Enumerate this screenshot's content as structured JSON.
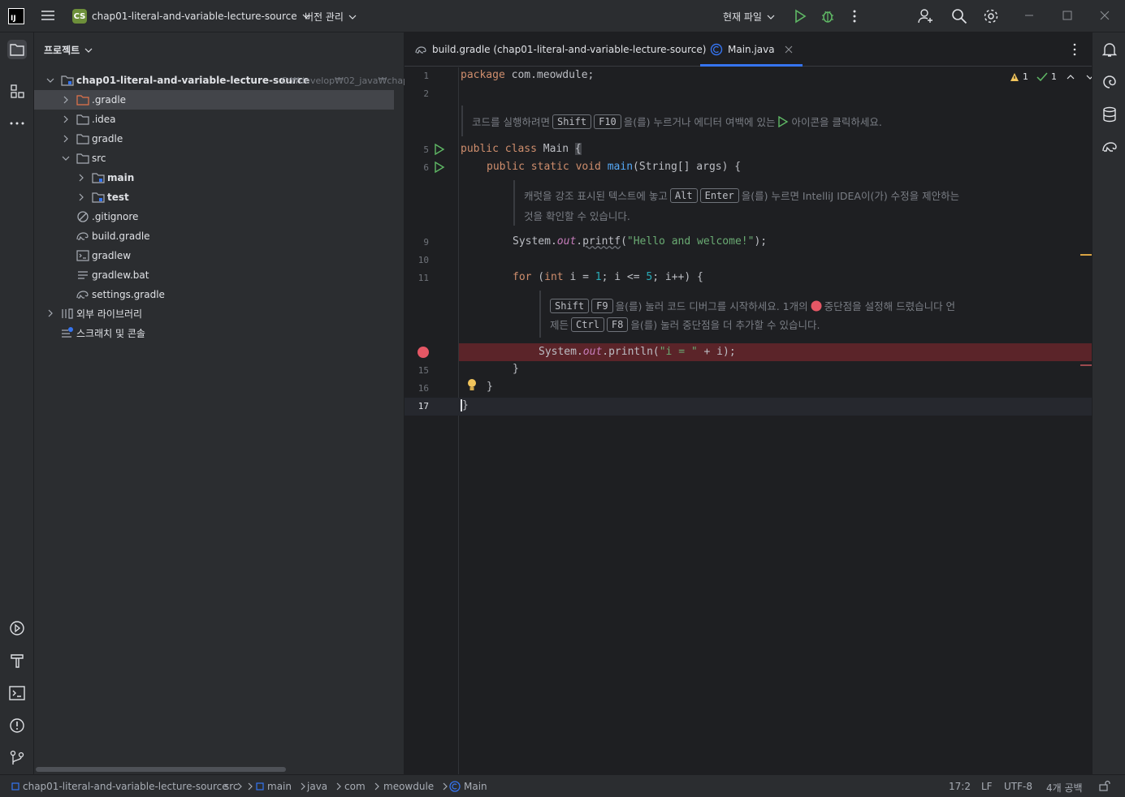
{
  "titlebar": {
    "app_logo": "IJ",
    "menu_icon": "hamburger-icon",
    "project_badge": "CS",
    "project_name": "chap01-literal-and-variable-lecture-source",
    "vcs_label": "버전 관리",
    "run_config": "현재 파일"
  },
  "project_panel": {
    "title": "프로젝트",
    "root_name": "chap01-literal-and-variable-lecture-source",
    "root_path": "C:₩develop₩02_java₩chap01-literal-and-variable-lecture-source",
    "items": [
      {
        "label": ".gradle",
        "icon": "folder-icon"
      },
      {
        "label": ".idea",
        "icon": "folder-icon"
      },
      {
        "label": "gradle",
        "icon": "folder-icon"
      },
      {
        "label": "src",
        "icon": "folder-icon"
      },
      {
        "label": "main",
        "icon": "source-folder-icon"
      },
      {
        "label": "test",
        "icon": "source-folder-icon"
      },
      {
        "label": ".gitignore",
        "icon": "ignore-file-icon"
      },
      {
        "label": "build.gradle",
        "icon": "gradle-icon"
      },
      {
        "label": "gradlew",
        "icon": "terminal-file-icon"
      },
      {
        "label": "gradlew.bat",
        "icon": "text-file-icon"
      },
      {
        "label": "settings.gradle",
        "icon": "gradle-icon"
      },
      {
        "label": "외부 라이브러리",
        "icon": "library-icon"
      },
      {
        "label": "스크래치 및 콘솔",
        "icon": "scratch-icon"
      }
    ]
  },
  "tabs": [
    {
      "label": "build.gradle (chap01-literal-and-variable-lecture-source)"
    },
    {
      "label": "Main.java"
    }
  ],
  "editor": {
    "line_numbers": [
      "1",
      "2",
      "5",
      "6",
      "9",
      "10",
      "11",
      "15",
      "16",
      "17"
    ],
    "code": {
      "line1_kw": "package",
      "line1_rest": " com.meowdule;",
      "line5_kw": "public class",
      "line5_rest": " Main ",
      "line5_brace": "{",
      "line6_kw": "public static void",
      "line6_fn": " main",
      "line6_rest": "(String[] args) {",
      "line9_a": "System.",
      "line9_out": "out",
      "line9_b": ".",
      "line9_fn": "printf",
      "line9_c": "(",
      "line9_str": "\"Hello and welcome!\"",
      "line9_d": ");",
      "line11_kw": "for",
      "line11_a": " (",
      "line11_kw2": "int",
      "line11_b": " i = ",
      "line11_n1": "1",
      "line11_c": "; i <= ",
      "line11_n2": "5",
      "line11_d": "; i++) {",
      "line14_a": "System.",
      "line14_out": "out",
      "line14_b": ".println(",
      "line14_str": "\"i = \"",
      "line14_c": " + i);",
      "line15": "}",
      "line16": "}",
      "line17": "}"
    },
    "hints": {
      "h1_a": "코드를 실행하려면",
      "h1_k1": "Shift",
      "h1_k2": "F10",
      "h1_b": "을(를) 누르거나 에디터 여백에 있는",
      "h1_c": "아이콘을 클릭하세요.",
      "h2_a": "캐럿을 강조 표시된 텍스트에 놓고",
      "h2_k1": "Alt",
      "h2_k2": "Enter",
      "h2_b": "을(를) 누르면 IntelliJ IDEA이(가) 수정을 제안하는",
      "h2_c": "것을 확인할 수 있습니다.",
      "h3_k1": "Shift",
      "h3_k2": "F9",
      "h3_a": "을(를) 눌러 코드 디버그를 시작하세요. 1개의",
      "h3_b": "중단점을 설정해 드렸습니다 언",
      "h3_c": "제든",
      "h3_k3": "Ctrl",
      "h3_k4": "F8",
      "h3_d": "을(를) 눌러 중단점을 더 추가할 수 있습니다."
    },
    "inspection": {
      "warnings": "1",
      "ok": "1"
    }
  },
  "statusbar": {
    "crumbs": [
      "chap01-literal-and-variable-lecture-source",
      "src",
      "main",
      "java",
      "com",
      "meowdule",
      "Main"
    ],
    "position": "17:2",
    "line_ending": "LF",
    "encoding": "UTF-8",
    "indent": "4개 공백"
  },
  "colors": {
    "keyword": "#cf8e6d",
    "function": "#56a8f5",
    "string": "#6aab73",
    "number": "#2aacb8",
    "breakpoint": "#e55765",
    "run_green": "#5fb865",
    "accent": "#3574f0"
  }
}
